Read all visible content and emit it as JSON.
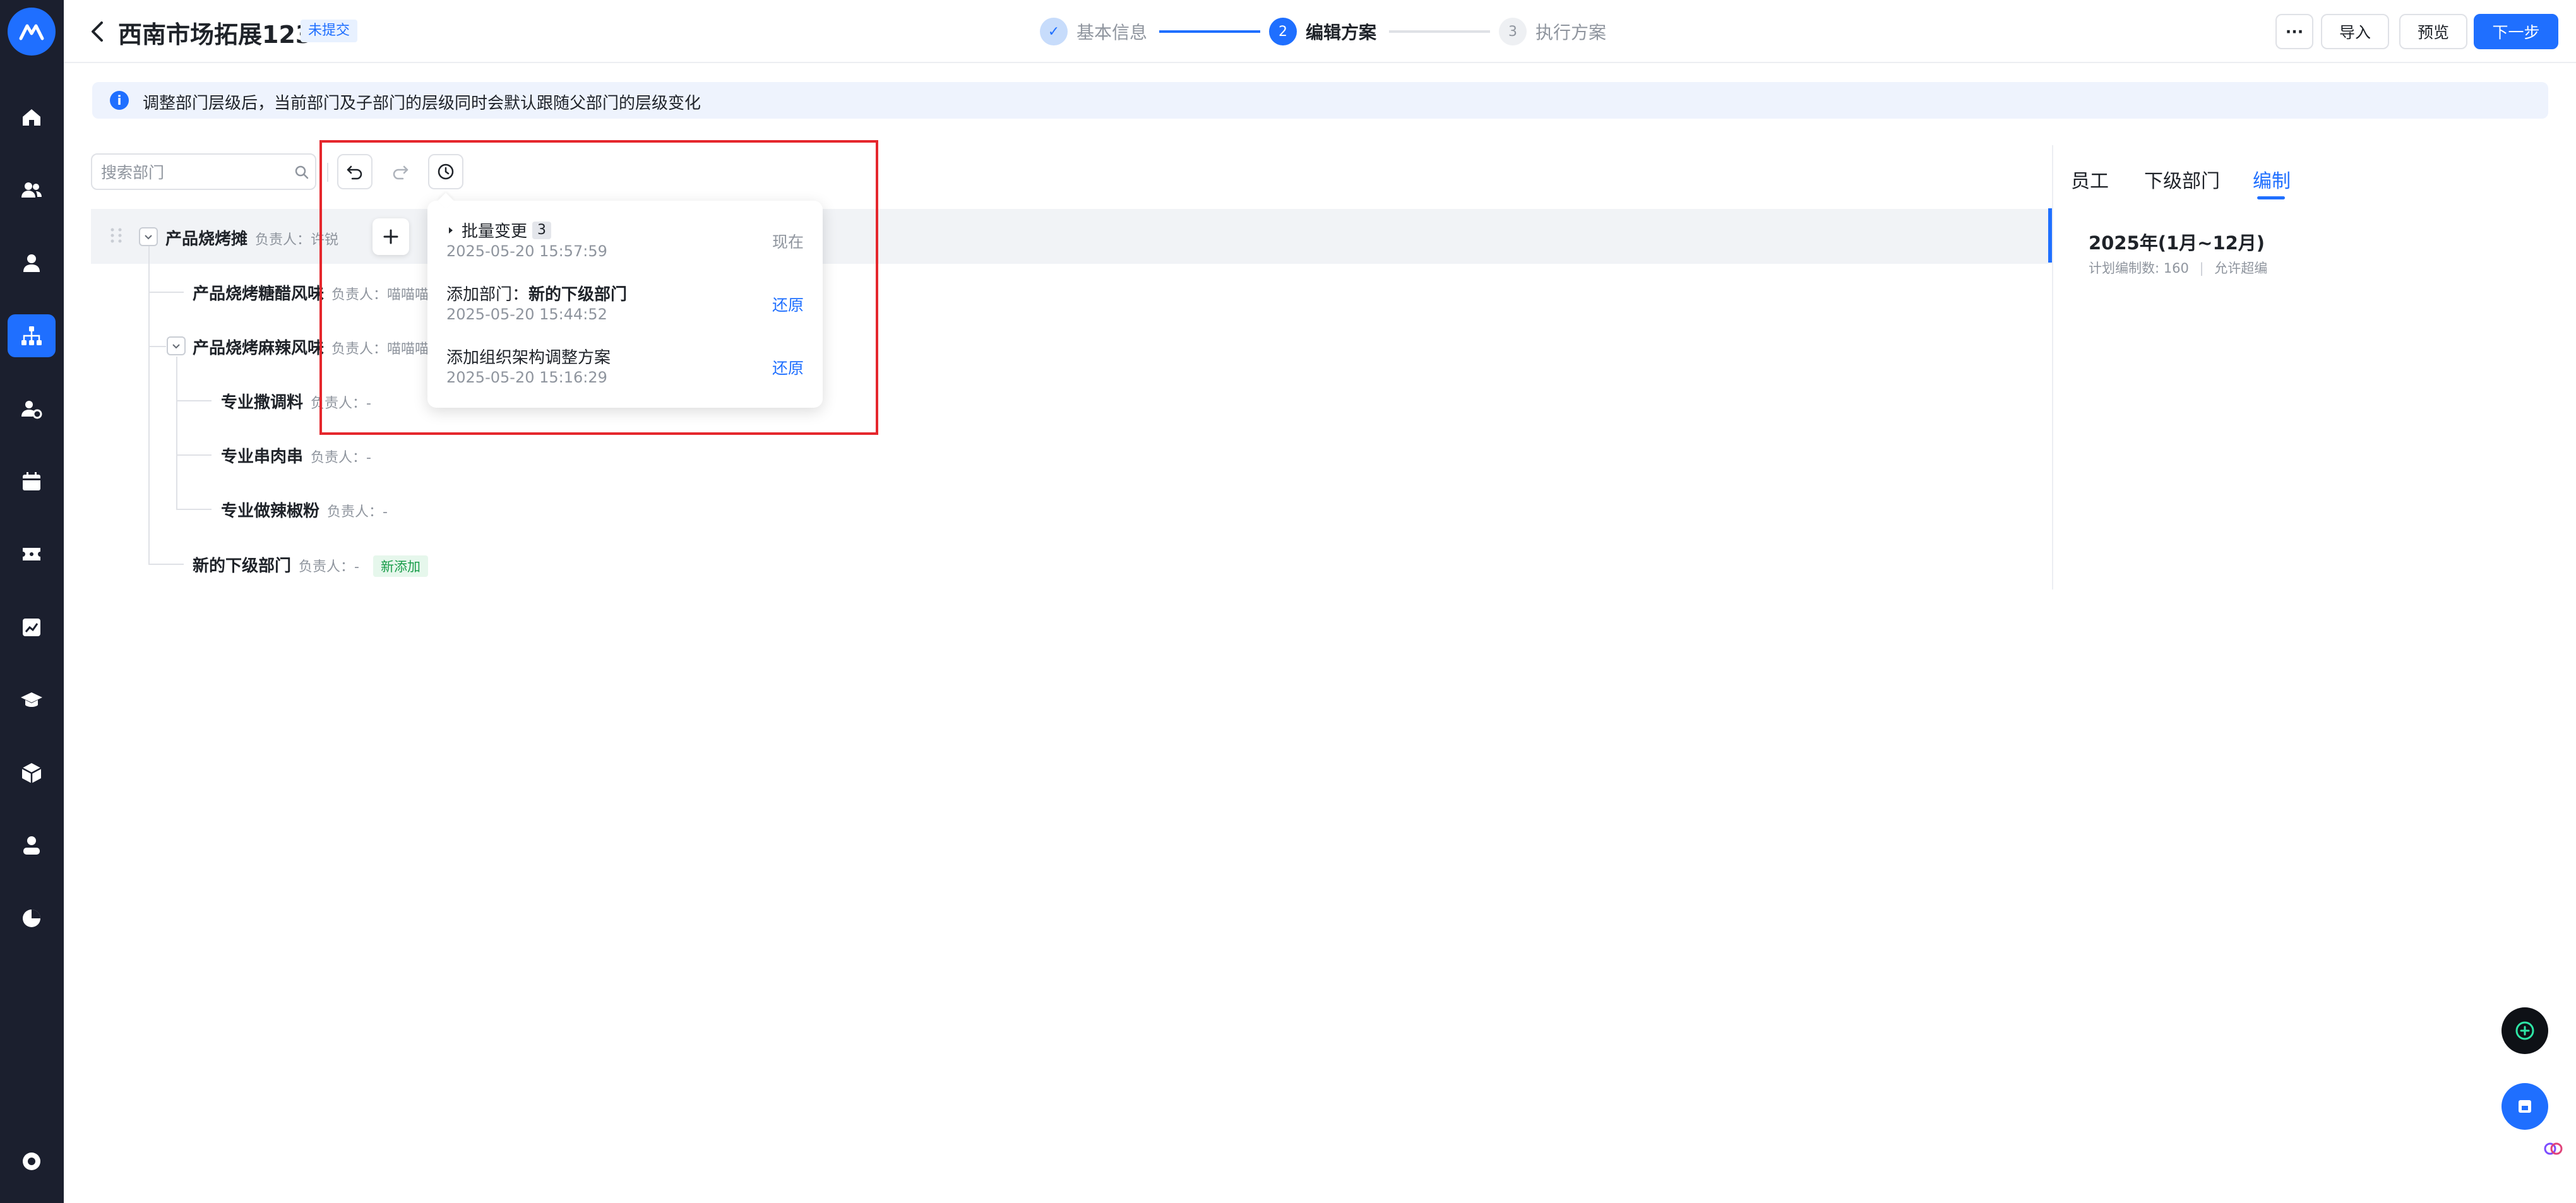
{
  "header": {
    "title": "西南市场拓展123",
    "status_badge": "未提交",
    "steps": [
      {
        "number": "✓",
        "label": "基本信息",
        "state": "done"
      },
      {
        "number": "2",
        "label": "编辑方案",
        "state": "active"
      },
      {
        "number": "3",
        "label": "执行方案",
        "state": "todo"
      }
    ],
    "more_label": "···",
    "import_label": "导入",
    "preview_label": "预览",
    "next_label": "下一步"
  },
  "sidebar": {
    "items": [
      {
        "icon": "home-icon"
      },
      {
        "icon": "users-icon"
      },
      {
        "icon": "user-icon"
      },
      {
        "icon": "org-chart-icon",
        "active": true
      },
      {
        "icon": "user-settings-icon"
      },
      {
        "icon": "calendar-icon"
      },
      {
        "icon": "ticket-icon"
      },
      {
        "icon": "report-icon"
      },
      {
        "icon": "graduation-cap-icon"
      },
      {
        "icon": "box-icon"
      },
      {
        "icon": "person-icon"
      },
      {
        "icon": "pie-chart-icon"
      }
    ],
    "bottom_icon": "settings-icon"
  },
  "info": {
    "text": "调整部门层级后，当前部门及子部门的层级同时会默认跟随父部门的层级变化"
  },
  "toolbar": {
    "search_placeholder": "搜索部门"
  },
  "tree": {
    "owner_label": "负责人：",
    "nodes": [
      {
        "name": "产品烧烤摊",
        "owner": "许锐"
      },
      {
        "name": "产品烧烤糖醋风味",
        "owner": "喵喵喵"
      },
      {
        "name": "产品烧烤麻辣风味",
        "owner": "喵喵喵"
      },
      {
        "name": "专业撒调料",
        "owner": "-"
      },
      {
        "name": "专业串肉串",
        "owner": "-"
      },
      {
        "name": "专业做辣椒粉",
        "owner": "-"
      },
      {
        "name": "新的下级部门",
        "owner": "-",
        "tag": "新添加"
      }
    ]
  },
  "history": {
    "items": [
      {
        "title": "批量变更",
        "count": "3",
        "time": "2025-05-20 15:57:59",
        "action": "现在"
      },
      {
        "title_prefix": "添加部门：",
        "title_bold": "新的下级部门",
        "time": "2025-05-20 15:44:52",
        "action": "还原"
      },
      {
        "title": "添加组织架构调整方案",
        "time": "2025-05-20 15:16:29",
        "action": "还原"
      }
    ]
  },
  "right_panel": {
    "tabs": [
      "员工",
      "下级部门",
      "编制"
    ],
    "active_tab": "编制",
    "year": "2025年(1月~12月)",
    "plan_label": "计划编制数: 160",
    "separator": "|",
    "allow_label": "允许超编"
  },
  "colors": {
    "accent": "#1f6fff",
    "sidebar_bg": "#1b1f2e",
    "highlight_frame": "#e5272d",
    "new_tag": "#1a9d4a"
  }
}
